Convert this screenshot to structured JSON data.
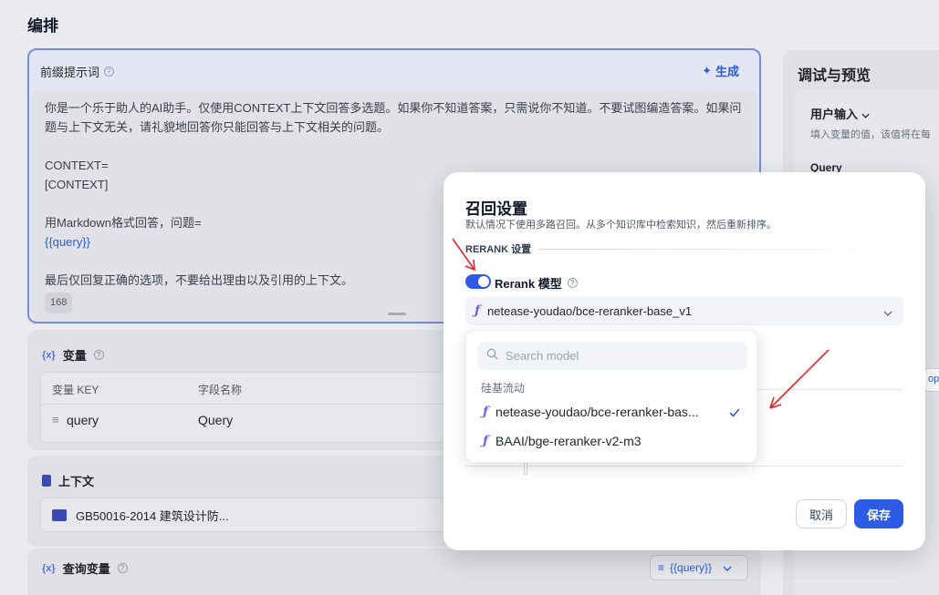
{
  "page": {
    "title": "编排"
  },
  "prompt": {
    "title": "前缀提示词",
    "generate_label": "生成",
    "lines": [
      "你是一个乐于助人的AI助手。仅使用CONTEXT上下文回答多选题。如果你不知道答案，只需说你不知道。不要试图编造答案。如果问",
      "题与上下文无关，请礼貌地回答你只能回答与上下文相关的问题。",
      "",
      "CONTEXT=",
      "[CONTEXT]",
      "",
      "用Markdown格式回答，问题="
    ],
    "token": "{{query}}",
    "last_line": "最后仅回复正确的选项，不要给出理由以及引用的上下文。",
    "char_count": "168"
  },
  "variables": {
    "fx": "{x}",
    "title": "变量",
    "col_key": "变量 KEY",
    "col_name": "字段名称",
    "row_key": "query",
    "row_name": "Query"
  },
  "context": {
    "title": "上下文",
    "kb_name": "GB50016-2014 建筑设计防..."
  },
  "query_var": {
    "fx": "{x}",
    "title": "查询变量",
    "value": "{{query}}"
  },
  "debug": {
    "title": "调试与预览",
    "user_input": "用户输入",
    "hint": "填入变量的值，该值将在每",
    "query_label": "Query",
    "partial_btn": "op"
  },
  "modal": {
    "title": "召回设置",
    "desc": "默认情况下使用多路召回。从多个知识库中检索知识，然后重新排序。",
    "section": "RERANK 设置",
    "rerank_label": "Rerank 模型",
    "rerank_enabled": true,
    "selected_model": "netease-youdao/bce-reranker-base_v1",
    "cancel": "取消",
    "save": "保存"
  },
  "dropdown": {
    "search_placeholder": "Search model",
    "group": "硅基流动",
    "items": [
      {
        "label": "netease-youdao/bce-reranker-bas...",
        "selected": true
      },
      {
        "label": "BAAI/bge-reranker-v2-m3",
        "selected": false
      }
    ]
  },
  "colors": {
    "accent": "#2e5be6",
    "arrow": "#e3242b",
    "model_icon": "#7c5ce0"
  }
}
